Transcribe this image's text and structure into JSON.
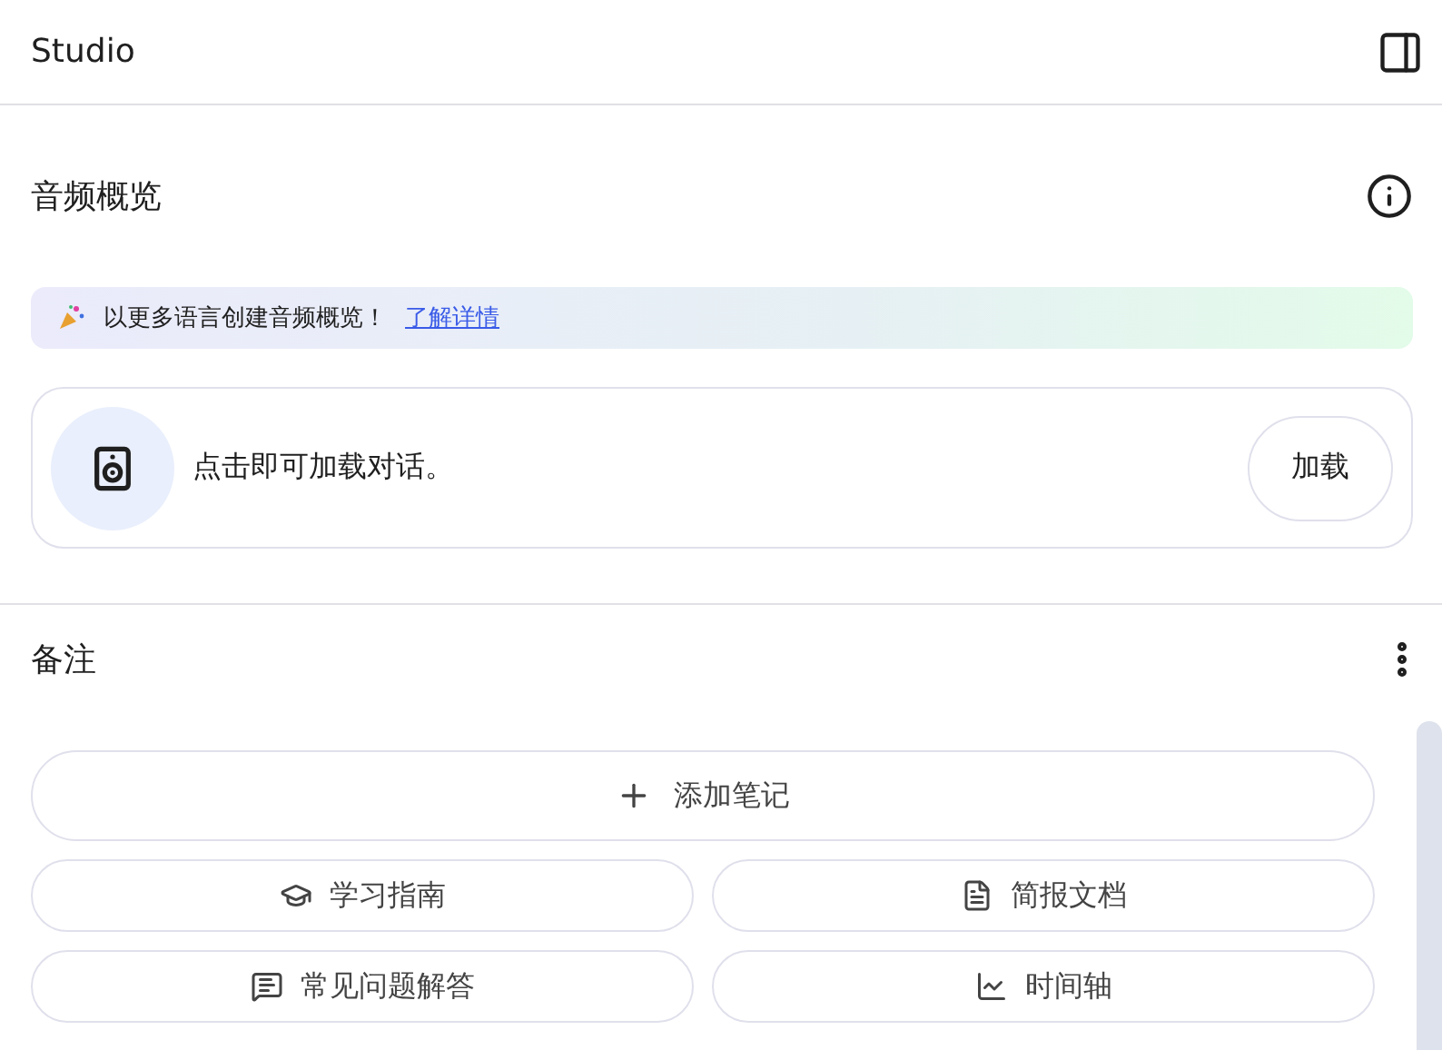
{
  "header": {
    "title": "Studio"
  },
  "audio_overview": {
    "title": "音频概览",
    "banner": {
      "text": "以更多语言创建音频概览！",
      "link": "了解详情"
    },
    "card": {
      "text": "点击即可加载对话。",
      "button": "加载"
    }
  },
  "notes": {
    "title": "备注",
    "add_button": "添加笔记",
    "actions": [
      {
        "kind": "guide",
        "label": "学习指南"
      },
      {
        "kind": "briefing",
        "label": "简报文档"
      },
      {
        "kind": "faq",
        "label": "常见问题解答"
      },
      {
        "kind": "timeline",
        "label": "时间轴"
      }
    ]
  }
}
